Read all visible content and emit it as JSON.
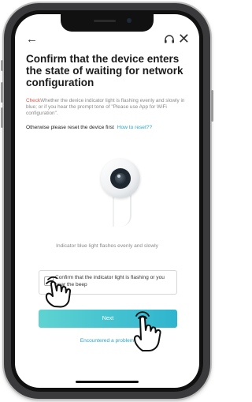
{
  "header": {
    "back_icon": "arrow-left-icon",
    "help_icon": "headset-icon",
    "close_icon": "close-icon"
  },
  "title": "Confirm that the device enters the state of waiting for network configuration",
  "description": {
    "check_word": "Check",
    "text": "Whether the device indicator light is flashing evenly and slowly in blue; or if you hear the prompt tone of \"Please use App for WiFi configuration\"."
  },
  "reset": {
    "text": "Otherwise please reset the device first",
    "link": "How to reset??"
  },
  "indicator_caption": "Indicator blue light flashes evenly and slowly",
  "confirm": {
    "label": "Confirm that the indicator light is flashing or you hear the beep"
  },
  "next_button": "Next",
  "encountered_link": "Encountered a problem",
  "colors": {
    "accent": "#2aa6c9",
    "check_red": "#e4574d",
    "button_start": "#5ed3d1",
    "button_end": "#2fb4cf"
  }
}
